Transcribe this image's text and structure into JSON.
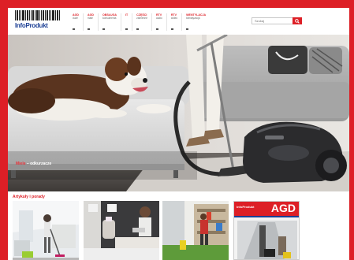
{
  "top_banner": {
    "ghost_text": ""
  },
  "header": {
    "logo": {
      "word": "InfoProdukt",
      "tagline": ""
    },
    "nav": [
      {
        "label": "AGD",
        "sub": "duże"
      },
      {
        "label": "AGD",
        "sub": "małe"
      },
      {
        "label": "Obsługa",
        "sub": "konsumenta"
      },
      {
        "label": "IT",
        "sub": ""
      },
      {
        "label": "Części",
        "sub": "zamienne"
      },
      {
        "label": "RTV",
        "sub": "audio"
      },
      {
        "label": "RTV",
        "sub": "wideo"
      },
      {
        "label": "Wentylacja",
        "sub": "klimatyzacja"
      }
    ],
    "search": {
      "placeholder": "Szukaj"
    }
  },
  "hero": {
    "brand": "Miele",
    "separator": " – ",
    "caption": "odkurzacze"
  },
  "articles": {
    "title": "Artykuły i porady",
    "magazine": {
      "logo": "InfoProdukt",
      "title": "AGD"
    }
  },
  "colors": {
    "accent": "#dd1f26",
    "logo_blue": "#1c3f94"
  },
  "icons": {
    "search": "search-icon"
  }
}
